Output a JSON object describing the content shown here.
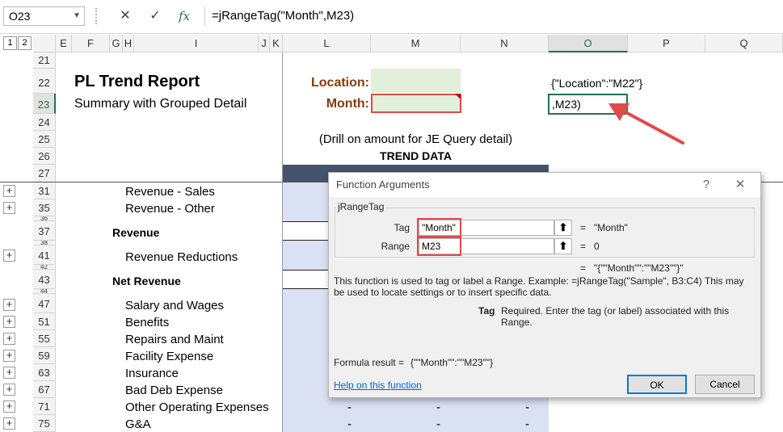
{
  "formula_bar": {
    "name_box": "O23",
    "cancel_icon": "✕",
    "enter_icon": "✓",
    "fx_label": "fx",
    "formula": "=jRangeTag(\"Month\",M23)"
  },
  "outline_levels": [
    "1",
    "2"
  ],
  "columns": [
    "E",
    "F",
    "G",
    "H",
    "I",
    "J",
    "K",
    "L",
    "M",
    "N",
    "O",
    "P",
    "Q"
  ],
  "rows": [
    "21",
    "22",
    "23",
    "24",
    "25",
    "26",
    "27",
    "31",
    "35",
    "36",
    "37",
    "38",
    "41",
    "42",
    "43",
    "44",
    "47",
    "51",
    "55",
    "59",
    "63",
    "67",
    "71",
    "75"
  ],
  "report": {
    "title": "PL Trend Report",
    "subtitle": "Summary with Grouped Detail",
    "location_label": "Location:",
    "month_label": "Month:",
    "drill_note": "(Drill on amount for JE Query detail)",
    "trend_header": "TREND DATA",
    "o22_value": "{\"Location\":\"M22\"}",
    "o23_value": ",M23)"
  },
  "line_items": [
    {
      "row": "31",
      "label": "Revenue - Sales",
      "bold": false
    },
    {
      "row": "35",
      "label": "Revenue - Other",
      "bold": false
    },
    {
      "row": "37",
      "label": "Revenue",
      "bold": true
    },
    {
      "row": "41",
      "label": "Revenue Reductions",
      "bold": false
    },
    {
      "row": "43",
      "label": "Net Revenue",
      "bold": true
    },
    {
      "row": "47",
      "label": "Salary and Wages",
      "bold": false
    },
    {
      "row": "51",
      "label": "Benefits",
      "bold": false
    },
    {
      "row": "55",
      "label": "Repairs and Maint",
      "bold": false
    },
    {
      "row": "59",
      "label": "Facility Expense",
      "bold": false
    },
    {
      "row": "63",
      "label": "Insurance",
      "bold": false
    },
    {
      "row": "67",
      "label": "Bad Deb Expense",
      "bold": false
    },
    {
      "row": "71",
      "label": "Other Operating Expenses",
      "bold": false
    },
    {
      "row": "75",
      "label": "G&A",
      "bold": false
    }
  ],
  "dash_values": [
    "-",
    "-",
    "-"
  ],
  "dialog": {
    "title": "Function Arguments",
    "help_icon": "?",
    "close_icon": "✕",
    "function_name": "jRangeTag",
    "tag_label": "Tag",
    "tag_value": "\"Month\"",
    "tag_result": "\"Month\"",
    "range_label": "Range",
    "range_value": "M23",
    "range_result": "0",
    "equals": "=",
    "overall_result": "\"{\"\"Month\"\":\"\"M23\"\"}\"",
    "description": "This function is used to tag or label a Range. Example: =jRangeTag(\"Sample\", B3:C4) This may be used to locate settings or to insert specific data.",
    "arg_name": "Tag",
    "arg_help": "Required. Enter the tag (or label) associated with this Range.",
    "formula_result_label": "Formula result =",
    "formula_result_value": "{\"\"Month\"\":\"\"M23\"\"}",
    "help_link": "Help on this function",
    "ok_label": "OK",
    "cancel_label": "Cancel"
  },
  "colors": {
    "accent_red": "#e04a4a",
    "excel_green": "#217346",
    "label_brown": "#843c0c",
    "header_navy": "#44546a",
    "band_blue": "#d9e1f2",
    "input_green": "#e2efda"
  }
}
